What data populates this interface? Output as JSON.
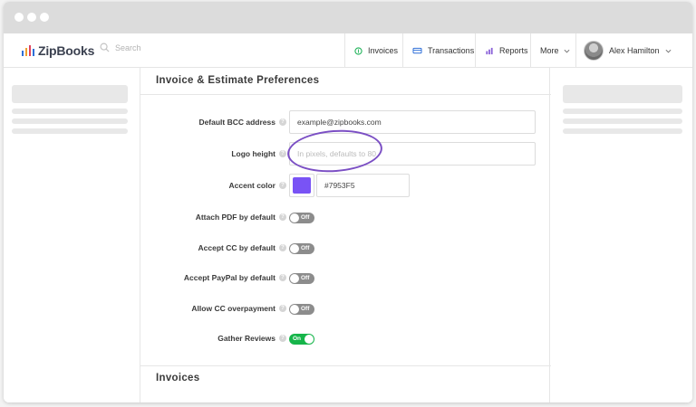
{
  "app": {
    "name": "ZipBooks",
    "brand_colors": [
      "#2e6fd8",
      "#f0a22e",
      "#e0415d",
      "#2e6fd8"
    ]
  },
  "search": {
    "placeholder": "Search"
  },
  "nav": {
    "items": [
      {
        "label": "Invoices",
        "icon": "invoice-icon"
      },
      {
        "label": "Transactions",
        "icon": "transactions-icon"
      },
      {
        "label": "Reports",
        "icon": "reports-icon"
      },
      {
        "label": "More",
        "icon": "chevron-down-icon"
      }
    ],
    "user": {
      "name": "Alex Hamilton",
      "icon": "chevron-down-icon"
    }
  },
  "preferences": {
    "title": "Invoice & Estimate Preferences",
    "fields": {
      "bcc": {
        "label": "Default BCC address",
        "value": "example@zipbooks.com"
      },
      "logo_height": {
        "label": "Logo height",
        "placeholder": "In pixels, defaults to 80"
      },
      "accent_color": {
        "label": "Accent color",
        "value": "#7953F5",
        "swatch": "#7953F5"
      }
    },
    "toggles": [
      {
        "label": "Attach PDF by default",
        "state": "Off"
      },
      {
        "label": "Accept CC by default",
        "state": "Off"
      },
      {
        "label": "Accept PayPal by default",
        "state": "Off"
      },
      {
        "label": "Allow CC overpayment",
        "state": "Off"
      },
      {
        "label": "Gather Reviews",
        "state": "On"
      }
    ],
    "help_glyph": "?"
  },
  "invoices_section": {
    "title": "Invoices"
  },
  "colors": {
    "highlight_circle": "#7b4fc4",
    "toggle_on": "#16b54a",
    "toggle_off": "#8c8c8c"
  }
}
